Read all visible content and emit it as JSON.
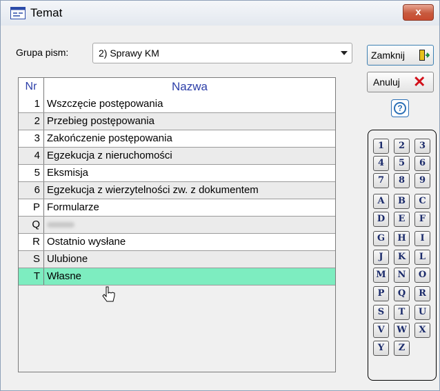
{
  "window": {
    "title": "Temat",
    "close_label": "x"
  },
  "grupa": {
    "label": "Grupa pism:",
    "selected": "2) Sprawy KM"
  },
  "table": {
    "headers": {
      "nr": "Nr",
      "name": "Nazwa"
    },
    "rows": [
      {
        "nr": "1",
        "name": "Wszczęcie postępowania"
      },
      {
        "nr": "2",
        "name": "Przebieg postępowania"
      },
      {
        "nr": "3",
        "name": "Zakończenie postępowania"
      },
      {
        "nr": "4",
        "name": "Egzekucja z nieruchomości"
      },
      {
        "nr": "5",
        "name": "Eksmisja"
      },
      {
        "nr": "6",
        "name": "Egzekucja z wierzytelności zw. z dokumentem"
      },
      {
        "nr": "P",
        "name": "Formularze"
      },
      {
        "nr": "Q",
        "name": ""
      },
      {
        "nr": "R",
        "name": "Ostatnio wysłane"
      },
      {
        "nr": "S",
        "name": "Ulubione"
      },
      {
        "nr": "T",
        "name": "Własne"
      }
    ],
    "selected_nr": "T"
  },
  "buttons": {
    "close": "Zamknij",
    "cancel": "Anuluj",
    "help": "?"
  },
  "keypad": [
    "1",
    "2",
    "3",
    "4",
    "5",
    "6",
    "7",
    "8",
    "9",
    "A",
    "B",
    "C",
    "D",
    "E",
    "F",
    "G",
    "H",
    "I",
    "J",
    "K",
    "L",
    "M",
    "N",
    "O",
    "P",
    "Q",
    "R",
    "S",
    "T",
    "U",
    "V",
    "W",
    "X",
    "Y",
    "Z"
  ],
  "colors": {
    "selected_row": "#7dedc0",
    "header_text": "#2c3ea8",
    "cancel_icon": "#d2101a"
  },
  "icons": {
    "app": "window-icon",
    "close_door": "exit-door-icon",
    "cancel": "x-icon",
    "help": "question-icon",
    "pointer": "mouse-cursor-icon"
  }
}
